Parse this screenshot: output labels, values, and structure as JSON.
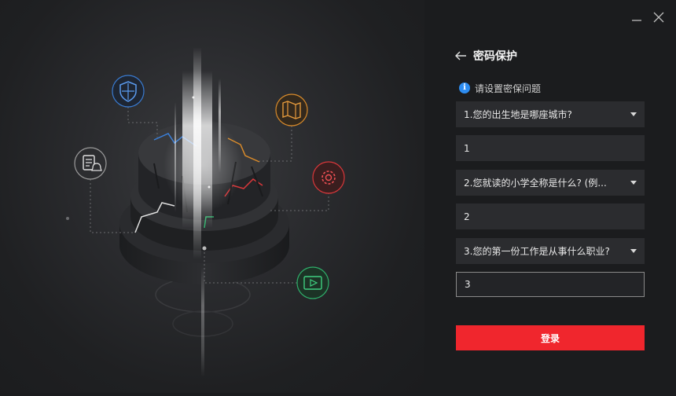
{
  "window": {
    "minimize_icon": "minimize-icon",
    "close_icon": "close-icon"
  },
  "header": {
    "title": "密码保护",
    "back_icon": "arrow-left-icon"
  },
  "hint": {
    "icon": "info-icon",
    "info_glyph": "i",
    "text": "请设置密保问题"
  },
  "questions": [
    {
      "select": "1.您的出生地是哪座城市?",
      "answer": "1"
    },
    {
      "select": "2.您就读的小学全称是什么? (例...",
      "answer": "2"
    },
    {
      "select": "3.您的第一份工作是从事什么职业?",
      "answer": "3"
    }
  ],
  "login_label": "登录",
  "illustration": {
    "icons": [
      "shield-icon",
      "map-icon",
      "document-bell-icon",
      "gear-icon",
      "video-icon"
    ],
    "colors": {
      "shield": "#3a7fd9",
      "map": "#d88a2a",
      "document": "#c8c8c8",
      "gear": "#d8373a",
      "video": "#2fae6a"
    }
  },
  "colors": {
    "accent": "#f0262d",
    "info": "#2d8cf0",
    "background": "#1b1c1e",
    "field": "#2b2c2f"
  }
}
